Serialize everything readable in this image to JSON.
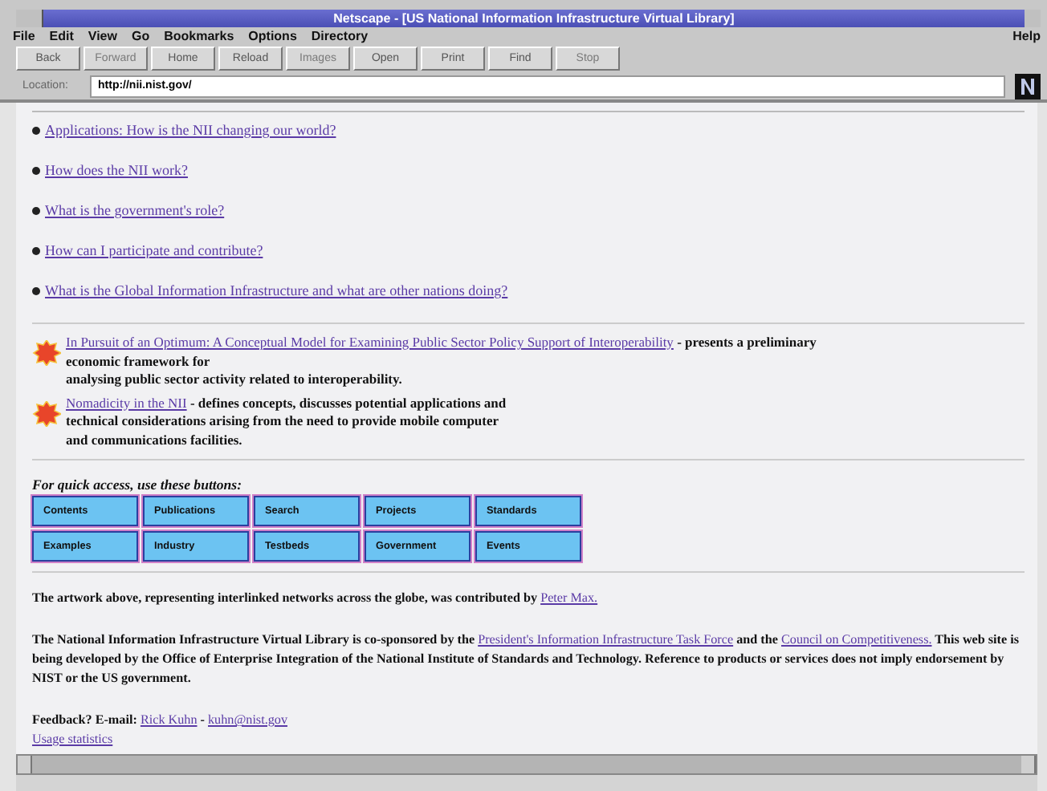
{
  "window": {
    "title": "Netscape - [US National Information Infrastructure Virtual Library]"
  },
  "menu": [
    {
      "label": "File"
    },
    {
      "label": "Edit"
    },
    {
      "label": "View"
    },
    {
      "label": "Go"
    },
    {
      "label": "Bookmarks"
    },
    {
      "label": "Options"
    },
    {
      "label": "Directory"
    }
  ],
  "help_menu": "Help",
  "toolbar": [
    {
      "label": "Back",
      "disabled": false
    },
    {
      "label": "Forward",
      "disabled": true
    },
    {
      "label": "Home",
      "disabled": false
    },
    {
      "label": "Reload",
      "disabled": false
    },
    {
      "label": "Images",
      "disabled": true
    },
    {
      "label": "Open",
      "disabled": false
    },
    {
      "label": "Print",
      "disabled": false
    },
    {
      "label": "Find",
      "disabled": false
    },
    {
      "label": "Stop",
      "disabled": true
    }
  ],
  "location": {
    "label": "Location:",
    "value": "http://nii.nist.gov/"
  },
  "topics": [
    "Applications: How is the NII changing our world?",
    "How does the NII work?",
    "What is the government's role?",
    "How can I participate and contribute?",
    "What is the Global Information Infrastructure and what are other nations doing?"
  ],
  "features": [
    {
      "link": "In Pursuit of an Optimum: A Conceptual Model for Examining Public Sector Policy Support of Interoperability",
      "lines": [
        "- presents a preliminary",
        "economic framework for",
        "analysing public sector activity related to interoperability."
      ]
    },
    {
      "link": "Nomadicity in the NII",
      "lines": [
        "- defines concepts, discusses potential applications and",
        "technical considerations arising from the need to provide mobile computer",
        "and communications facilities."
      ]
    }
  ],
  "quick_access": {
    "label": "For quick access, use these buttons:",
    "rows": [
      [
        "Contents",
        "Publications",
        "Search",
        "Projects",
        "Standards"
      ],
      [
        "Examples",
        "Industry",
        "Testbeds",
        "Government",
        "Events"
      ]
    ]
  },
  "paragraphs": [
    {
      "lines": [
        [
          {
            "text": "The artwork above, representing interlinked networks across the globe, was contributed by ",
            "link": false
          },
          {
            "text": "Peter Max.",
            "link": true
          }
        ]
      ]
    },
    {
      "lines": [
        [
          {
            "text": "The National Information Infrastructure Virtual Library is co-sponsored by the ",
            "link": false
          },
          {
            "text": "President's Information Infrastructure Task Force",
            "link": true
          },
          {
            "text": " and the ",
            "link": false
          },
          {
            "text": "Council on Competitiveness.",
            "link": true
          },
          {
            "text": " This web site is being developed by the Office of Enterprise Integration of the National Institute of Standards and Technology. Reference to products or services does not imply endorsement by NIST or the US government.",
            "link": false
          }
        ]
      ]
    },
    {
      "lines": [
        [
          {
            "text": "Feedback? E-mail: ",
            "link": false
          },
          {
            "text": "Rick Kuhn",
            "link": true
          },
          {
            "text": " - ",
            "link": false
          },
          {
            "text": "kuhn@nist.gov",
            "link": true
          }
        ],
        [
          {
            "text": "Usage statistics",
            "link": true
          }
        ]
      ]
    }
  ]
}
